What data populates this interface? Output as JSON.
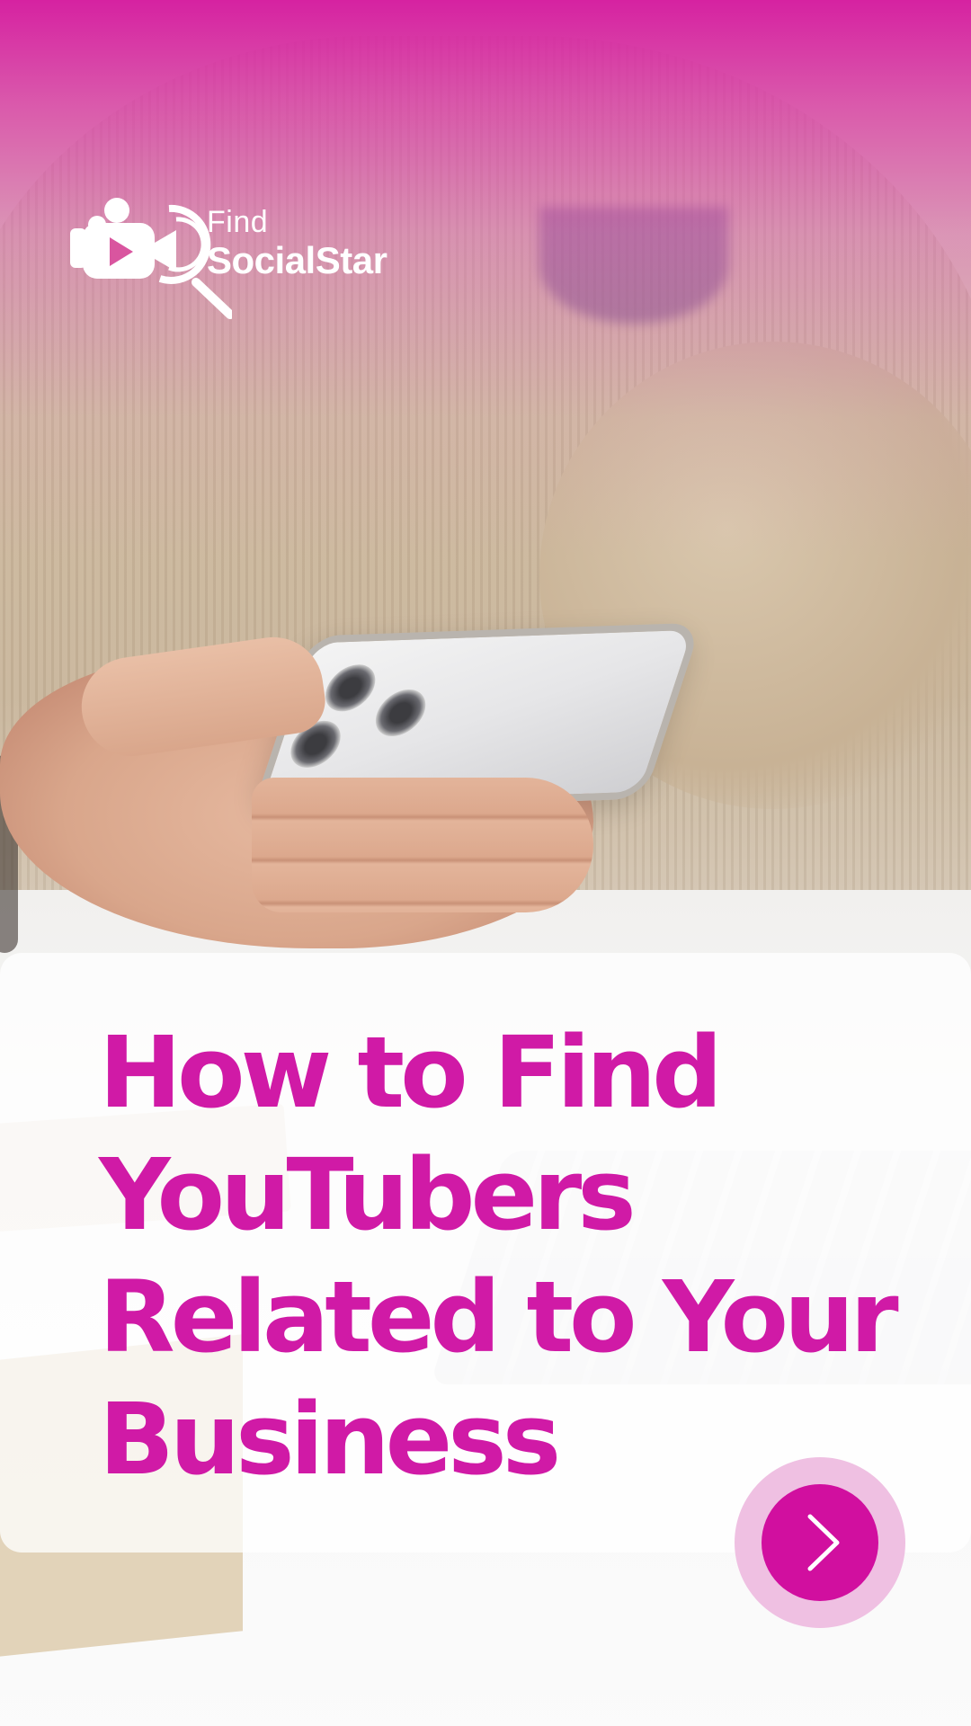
{
  "brand": {
    "find_text": "Find",
    "name_text": "SocialStar"
  },
  "headline": {
    "lines": [
      "How to Find",
      "YouTubers",
      "Related to Your",
      "Business"
    ]
  },
  "next_button": {
    "icon": "chevron-right-icon"
  },
  "colors": {
    "accent": "#d01aa6",
    "button_fill": "#d10f9f",
    "button_ring": "#efc0e2",
    "overlay_pink": "#d614a0"
  }
}
